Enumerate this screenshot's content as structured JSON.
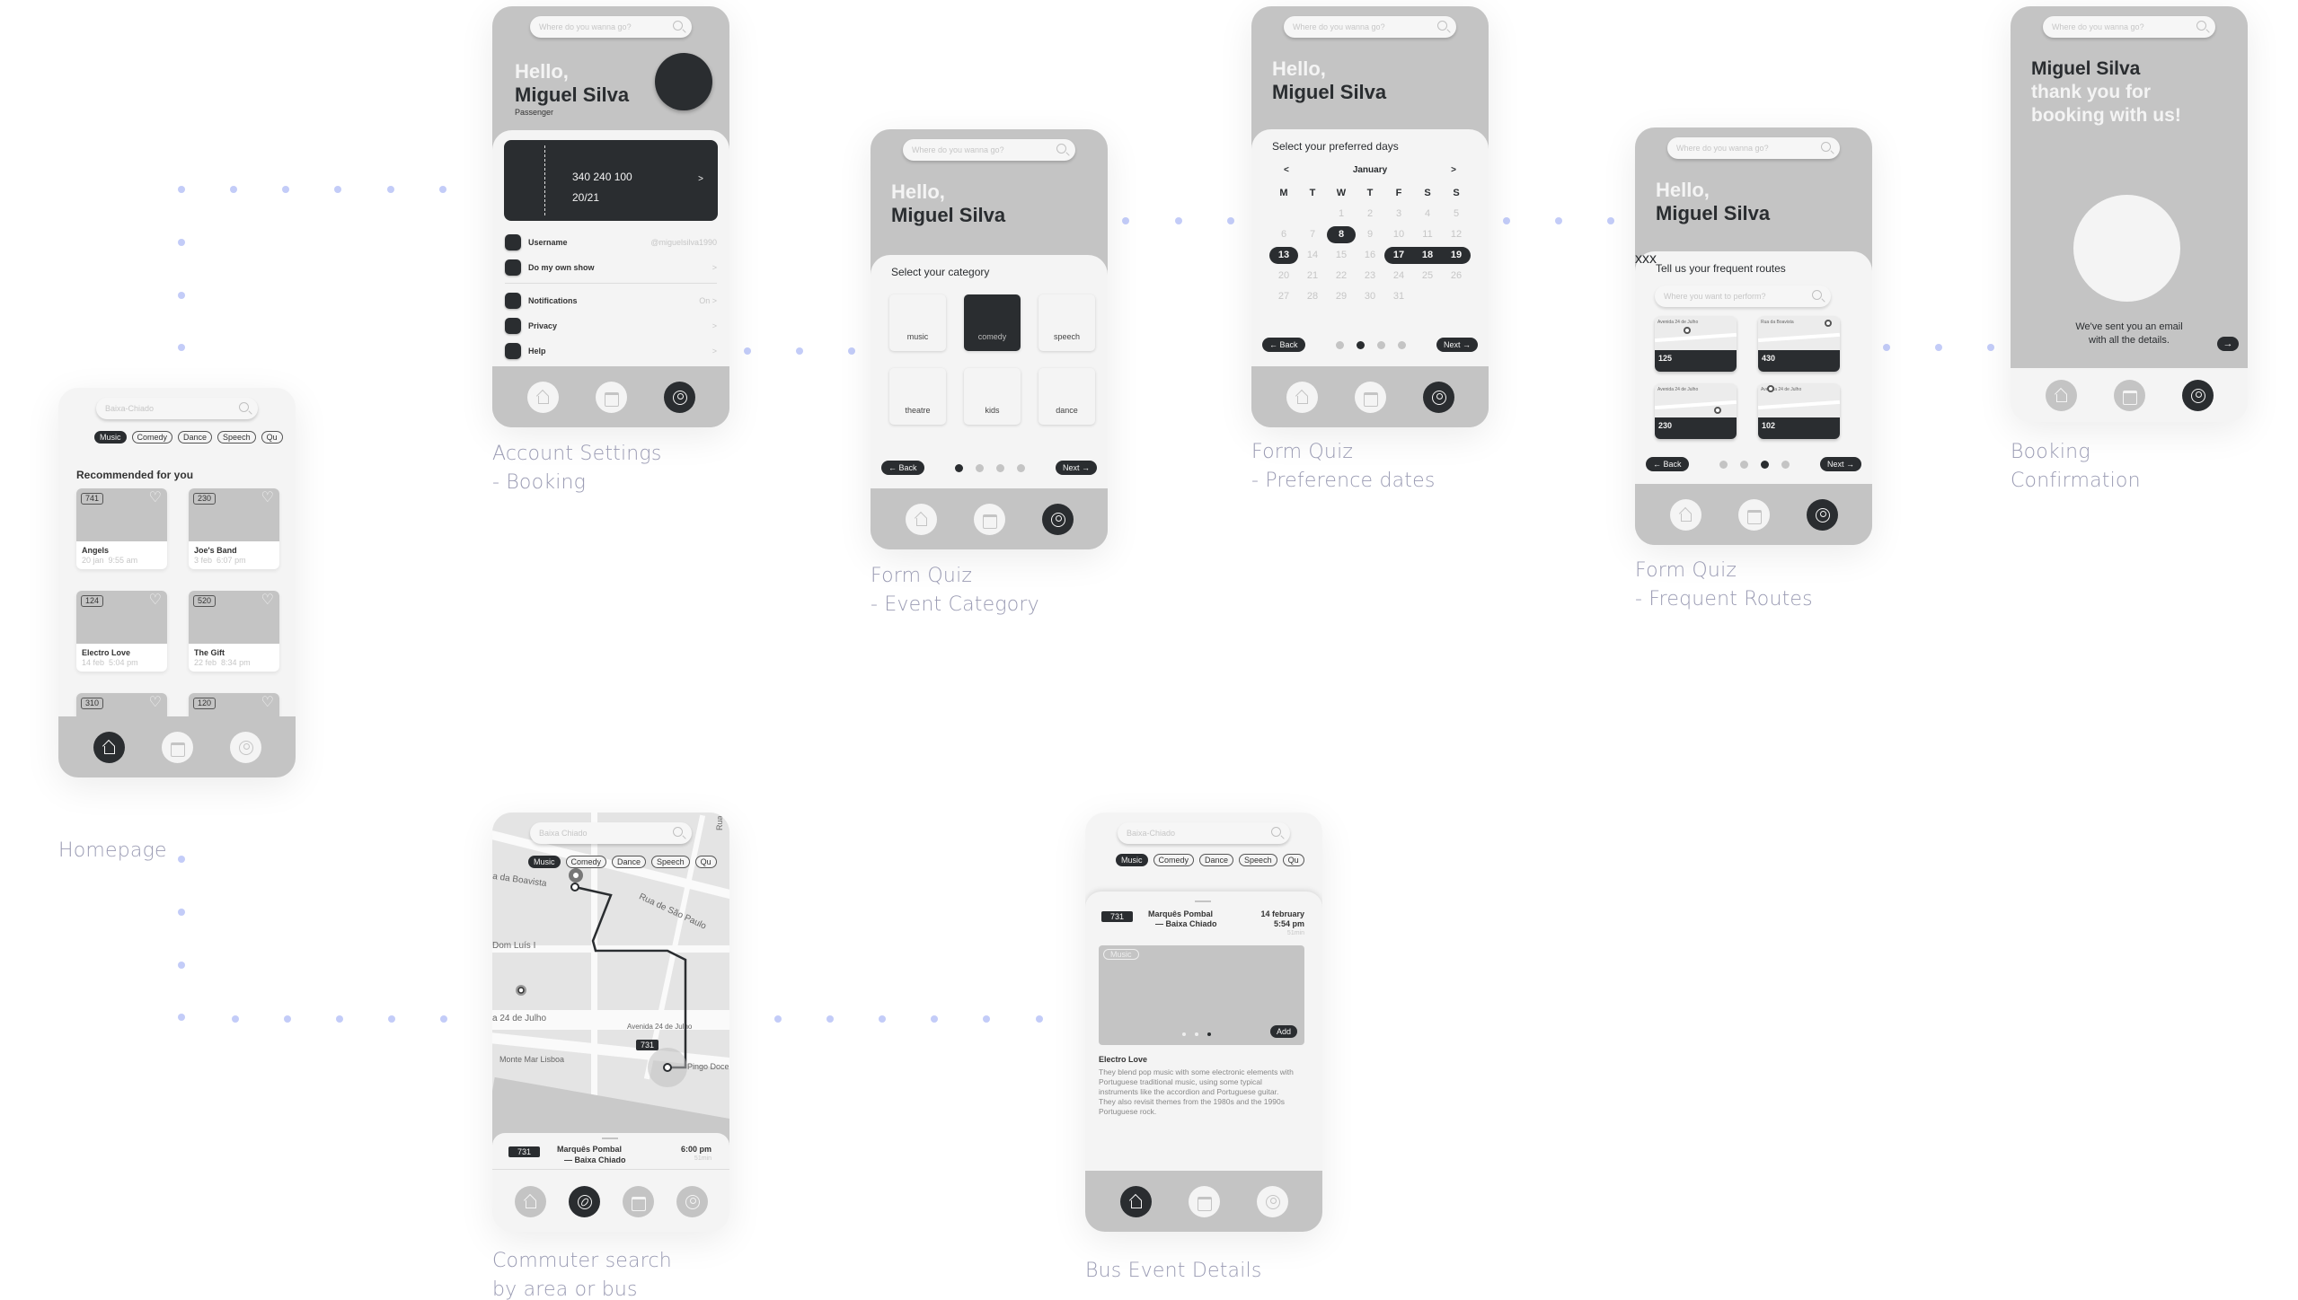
{
  "labels": {
    "homepage": "Homepage",
    "account_1": "Account Settings",
    "account_2": "- Booking",
    "category_1": "Form Quiz",
    "category_2": "- Event Category",
    "dates_1": "Form Quiz",
    "dates_2": "- Preference dates",
    "routes_1": "Form Quiz",
    "routes_2": "- Frequent Routes",
    "confirm_1": "Booking",
    "confirm_2": "Confirmation",
    "commuter_1": "Commuter search",
    "commuter_2": "by area or bus",
    "bus_event": "Bus Event Details"
  },
  "common": {
    "search_placeholder": "Where do you wanna go?",
    "hello": "Hello,",
    "user_name": "Miguel Silva",
    "back": "← Back",
    "next": "Next →",
    "chips": [
      "Music",
      "Comedy",
      "Dance",
      "Speech",
      "Qu"
    ]
  },
  "homepage": {
    "search_value": "Baixa-Chiado",
    "section_title": "Recommended for you",
    "cards": [
      {
        "bus": "741",
        "title": "Angels",
        "date": "20 jan",
        "time": "9:55 am"
      },
      {
        "bus": "230",
        "title": "Joe's Band",
        "date": "3 feb",
        "time": "6:07 pm"
      },
      {
        "bus": "124",
        "title": "Electro Love",
        "date": "14 feb",
        "time": "5:04 pm"
      },
      {
        "bus": "520",
        "title": "The Gift",
        "date": "22 feb",
        "time": "8:34 pm"
      },
      {
        "bus": "310",
        "title": "",
        "date": "",
        "time": ""
      },
      {
        "bus": "120",
        "title": "",
        "date": "",
        "time": ""
      }
    ]
  },
  "account": {
    "role": "Passenger",
    "pass_number": "340 240 100",
    "pass_validity": "20/21",
    "pass_chevron": ">",
    "rows": [
      {
        "key": "Username",
        "value": "@miguelsilva1990"
      },
      {
        "key": "Do my own show",
        "value": ">"
      },
      {
        "key": "Notifications",
        "value": "On  >"
      },
      {
        "key": "Privacy",
        "value": ">"
      },
      {
        "key": "Help",
        "value": ">"
      }
    ]
  },
  "category": {
    "title": "Select your category",
    "options": [
      "music",
      "comedy",
      "speech",
      "theatre",
      "kids",
      "dance"
    ],
    "selected": "comedy",
    "step": 1,
    "steps_total": 4
  },
  "dates": {
    "title": "Select your preferred days",
    "month": "January",
    "prev": "<",
    "next_month": ">",
    "weekdays": [
      "M",
      "T",
      "W",
      "T",
      "F",
      "S",
      "S"
    ],
    "days": [
      "",
      "",
      "1",
      "2",
      "3",
      "4",
      "5",
      "6",
      "7",
      "8",
      "9",
      "10",
      "11",
      "12",
      "13",
      "14",
      "15",
      "16",
      "17",
      "18",
      "19",
      "20",
      "21",
      "22",
      "23",
      "24",
      "25",
      "26",
      "27",
      "28",
      "29",
      "30",
      "31",
      "",
      "",
      ""
    ],
    "selected_days": [
      "8",
      "13",
      "17",
      "18",
      "19"
    ],
    "step": 2,
    "steps_total": 4
  },
  "routes": {
    "title": "Tell us your frequent routes",
    "search_placeholder": "Where you want to perform?",
    "remove_label": "x",
    "items": [
      {
        "bus": "125",
        "street": "Avenida 24 de Julho"
      },
      {
        "bus": "430",
        "street": "Rua da Boavista"
      },
      {
        "bus": "230",
        "street": "Avenida 24 de Julho"
      },
      {
        "bus": "102",
        "street": "Avenida 24 de Julho"
      }
    ],
    "step": 3,
    "steps_total": 4
  },
  "confirm": {
    "line1": "thank you for",
    "line2": "booking with us!",
    "message_1": "We've sent you an email",
    "message_2": "with all the details.",
    "arrow": "→"
  },
  "commuter": {
    "search_value": "Baixa Chiado",
    "map_labels": [
      "a da Boavista",
      "Rua de São Paulo",
      "Dom Luís I",
      "a 24 de Julho",
      "Avenida 24 de Julho",
      "Monte Mar Lisboa",
      "Pingo Doce",
      "Rua da F"
    ],
    "bus_tag": "731",
    "trip": {
      "bus": "731",
      "from": "Marquês Pombal",
      "to": "— Baixa Chiado",
      "time": "6:00 pm",
      "duration": "51min"
    }
  },
  "bus_event": {
    "search_value": "Baixa-Chiado",
    "trip": {
      "bus": "731",
      "from": "Marquês Pombal",
      "to": "— Baixa Chiado",
      "date": "14 february",
      "time": "5:54 pm",
      "duration": "51min"
    },
    "image_tag": "Music",
    "add_label": "Add",
    "event_title": "Electro Love",
    "description": "They blend pop music with some electronic elements with Portuguese traditional music, using some typical instruments like the accordion and Portuguese guitar. They also revisit themes from the 1980s and the 1990s Portuguese rock.",
    "carousel_active": 3,
    "carousel_total": 3
  },
  "colors": {
    "dark": "#2a2d30",
    "grey": "#c4c4c4",
    "light": "#f4f4f4",
    "connector": "#c3ccf8",
    "label": "#9a9bb3"
  }
}
